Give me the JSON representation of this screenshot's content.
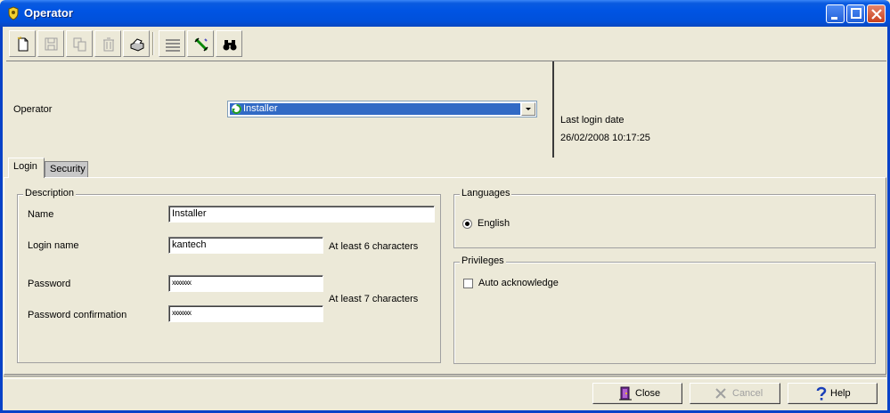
{
  "window": {
    "title": "Operator"
  },
  "toolbar": {
    "icons": [
      "new-icon",
      "save-icon",
      "copy-icon",
      "delete-icon",
      "print-icon",
      "list-icon",
      "link-icon",
      "find-icon"
    ]
  },
  "header": {
    "operator_label": "Operator",
    "operator_value": "Installer",
    "last_login_label": "Last login date",
    "last_login_value": "26/02/2008 10:17:25"
  },
  "tabs": [
    {
      "label": "Login",
      "active": true
    },
    {
      "label": "Security",
      "active": false
    }
  ],
  "description": {
    "legend": "Description",
    "name_label": "Name",
    "name_value": "Installer",
    "login_label": "Login name",
    "login_value": "kantech",
    "login_hint": "At least 6 characters",
    "password_label": "Password",
    "password_value": "xxxxxxx",
    "confirm_label": "Password confirmation",
    "confirm_value": "xxxxxxx",
    "password_hint": "At least 7 characters"
  },
  "languages": {
    "legend": "Languages",
    "option": "English",
    "selected": true
  },
  "privileges": {
    "legend": "Privileges",
    "option": "Auto acknowledge",
    "checked": false
  },
  "buttons": {
    "close": "Close",
    "cancel": "Cancel",
    "help": "Help"
  }
}
